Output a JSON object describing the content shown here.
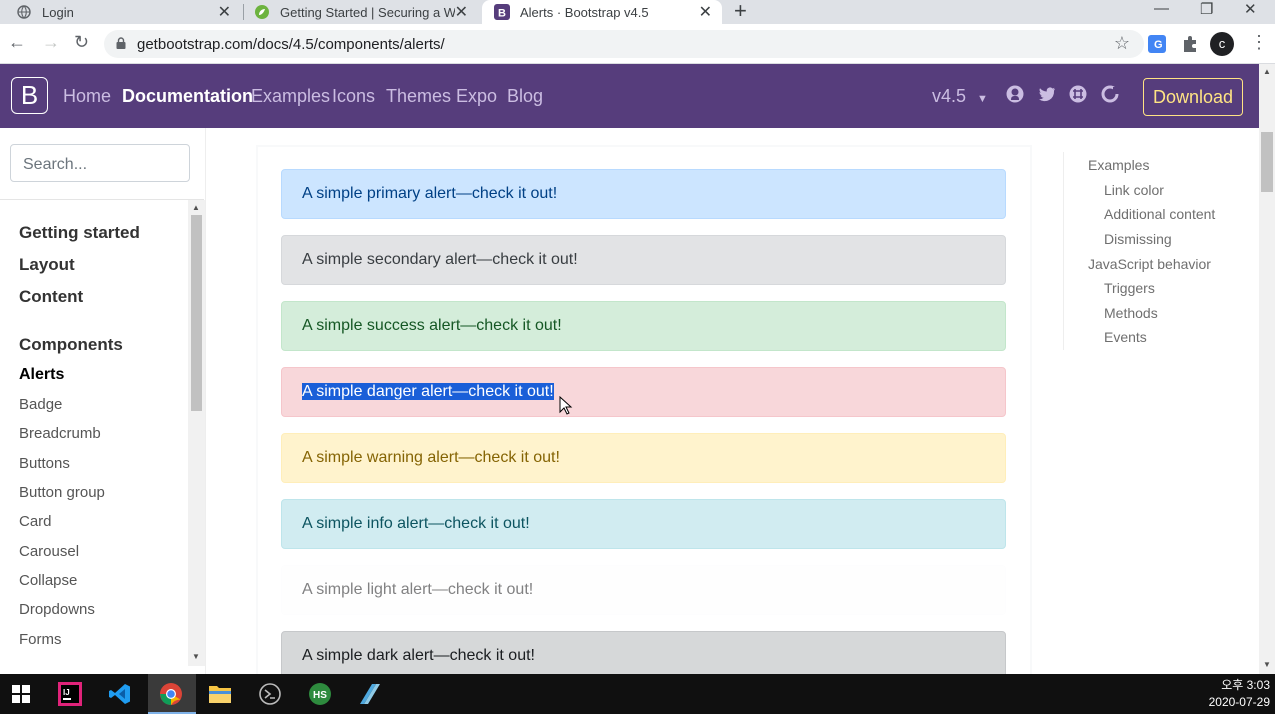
{
  "browser": {
    "tabs": [
      {
        "title": "Login",
        "icon": "globe-icon"
      },
      {
        "title": "Getting Started | Securing a We",
        "icon": "spring-leaf-icon"
      },
      {
        "title": "Alerts · Bootstrap v4.5",
        "icon": "bootstrap-icon"
      }
    ],
    "url": "getbootstrap.com/docs/4.5/components/alerts/",
    "profile_initial": "c"
  },
  "navbar": {
    "brand": "B",
    "links": [
      "Home",
      "Documentation",
      "Examples",
      "Icons",
      "Themes",
      "Expo",
      "Blog"
    ],
    "active_link": "Documentation",
    "version": "v4.5",
    "download_label": "Download",
    "brand_color": "#563d7c"
  },
  "sidebar": {
    "search_placeholder": "Search...",
    "groups": [
      "Getting started",
      "Layout",
      "Content",
      "Components"
    ],
    "active_item": "Alerts",
    "items": [
      "Badge",
      "Breadcrumb",
      "Buttons",
      "Button group",
      "Card",
      "Carousel",
      "Collapse",
      "Dropdowns",
      "Forms"
    ]
  },
  "alerts": {
    "primary": "A simple primary alert—check it out!",
    "secondary": "A simple secondary alert—check it out!",
    "success": "A simple success alert—check it out!",
    "danger": "A simple danger alert—check it out!",
    "warning": "A simple warning alert—check it out!",
    "info": "A simple info alert—check it out!",
    "light": "A simple light alert—check it out!",
    "dark": "A simple dark alert—check it out!"
  },
  "toc": {
    "items": [
      "Examples",
      "Link color",
      "Additional content",
      "Dismissing",
      "JavaScript behavior",
      "Triggers",
      "Methods",
      "Events"
    ]
  },
  "taskbar": {
    "time": "오후 3:03",
    "date": "2020-07-29"
  }
}
